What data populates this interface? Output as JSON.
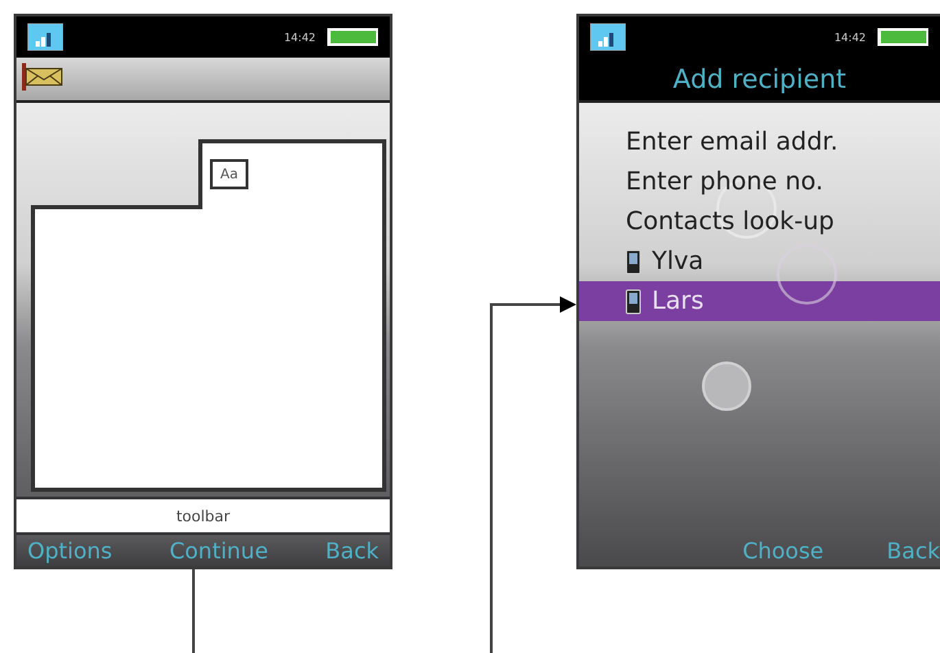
{
  "screens": [
    {
      "status": {
        "time": "14:42"
      },
      "header": {
        "kind": "icon"
      },
      "editor": {
        "format_label": "Aa"
      },
      "toolbar": {
        "label": "toolbar"
      },
      "softkeys": [
        "Options",
        "Continue",
        "Back"
      ]
    },
    {
      "status": {
        "time": "14:42"
      },
      "header": {
        "kind": "title",
        "title": "Add recipient"
      },
      "menu": [
        {
          "kind": "option",
          "label": "Enter email addr.",
          "selected": false
        },
        {
          "kind": "option",
          "label": "Enter phone no.",
          "selected": false
        },
        {
          "kind": "option",
          "label": "Contacts look-up",
          "selected": false
        },
        {
          "kind": "contact",
          "label": "Ylva",
          "selected": false
        },
        {
          "kind": "contact",
          "label": "Lars",
          "selected": true
        }
      ],
      "softkeys": [
        "Choose",
        "Back"
      ]
    }
  ]
}
